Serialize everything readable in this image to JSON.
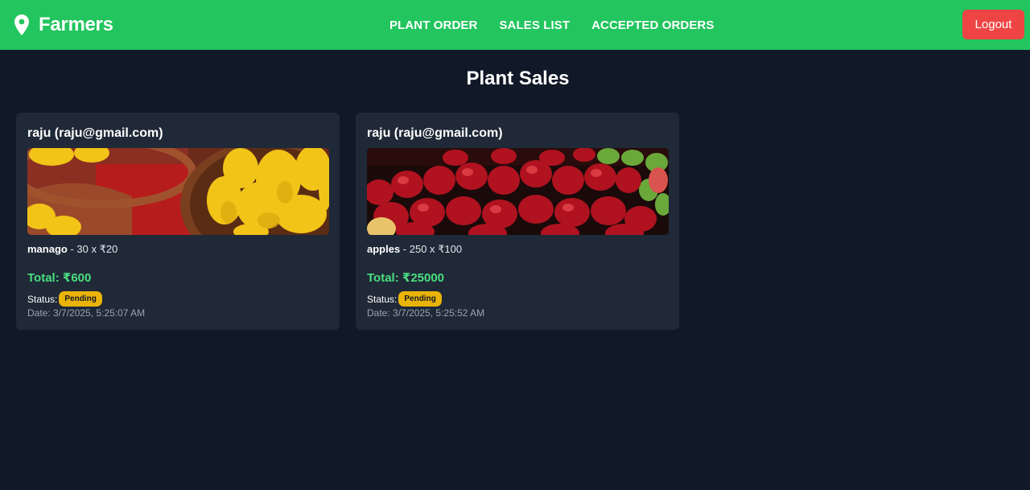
{
  "navbar": {
    "brand": "Farmers",
    "brand_icon": "map-pin-icon",
    "links": [
      "PLANT ORDER",
      "SALES LIST",
      "ACCEPTED ORDERS"
    ],
    "logout_label": "Logout",
    "colors": {
      "bar": "#22c55e",
      "logout": "#ef4444"
    }
  },
  "main": {
    "title": "Plant Sales",
    "cards": [
      {
        "user": "raju (raju@gmail.com)",
        "image": "mangoes-in-baskets",
        "product": "manago",
        "qty_price": " - 30 x ₹20",
        "total": "Total: ₹600",
        "status_label": "Status:",
        "status": "Pending",
        "date": "Date: 3/7/2025, 5:25:07 AM"
      },
      {
        "user": "raju (raju@gmail.com)",
        "image": "red-apples-display",
        "product": "apples",
        "qty_price": " - 250 x ₹100",
        "total": "Total: ₹25000",
        "status_label": "Status:",
        "status": "Pending",
        "date": "Date: 3/7/2025, 5:25:52 AM"
      }
    ]
  }
}
